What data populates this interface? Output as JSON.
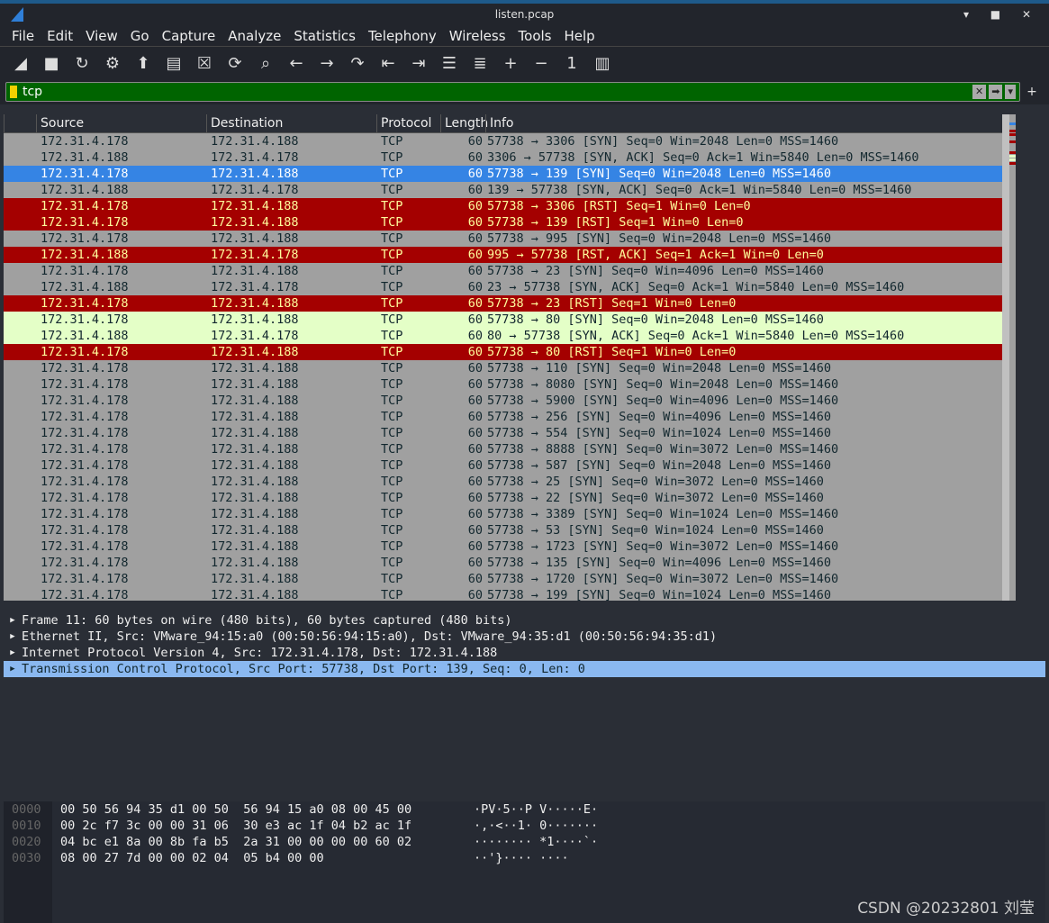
{
  "window": {
    "title": "listen.pcap",
    "controls": "▾ ■ ✕"
  },
  "menu": [
    "File",
    "Edit",
    "View",
    "Go",
    "Capture",
    "Analyze",
    "Statistics",
    "Telephony",
    "Wireless",
    "Tools",
    "Help"
  ],
  "toolbar": [
    {
      "icon": "shark-start-icon",
      "g": "◢"
    },
    {
      "icon": "stop-icon",
      "g": "■"
    },
    {
      "icon": "restart-icon",
      "g": "↻"
    },
    {
      "icon": "options-gear-icon",
      "g": "⚙"
    },
    {
      "icon": "open-icon",
      "g": "⬆"
    },
    {
      "icon": "file-icon",
      "g": "▤"
    },
    {
      "icon": "close-file-icon",
      "g": "☒"
    },
    {
      "icon": "reload-icon",
      "g": "⟳"
    },
    {
      "icon": "search-icon",
      "g": "⌕"
    },
    {
      "icon": "back-icon",
      "g": "←"
    },
    {
      "icon": "forward-icon",
      "g": "→"
    },
    {
      "icon": "goto-icon",
      "g": "↷"
    },
    {
      "icon": "first-packet-icon",
      "g": "⇤"
    },
    {
      "icon": "last-packet-icon",
      "g": "⇥"
    },
    {
      "icon": "autoscroll-icon",
      "g": "☰"
    },
    {
      "icon": "colorize-icon",
      "g": "≣"
    },
    {
      "icon": "zoom-in-icon",
      "g": "+"
    },
    {
      "icon": "zoom-out-icon",
      "g": "−"
    },
    {
      "icon": "normal-size-icon",
      "g": "1"
    },
    {
      "icon": "resize-columns-icon",
      "g": "▥"
    }
  ],
  "filter": {
    "value": "tcp",
    "add": "+"
  },
  "columns": [
    "",
    "Source",
    "Destination",
    "Protocol",
    "Length",
    "Info"
  ],
  "colors": {
    "gray": "#a0a0a0",
    "red": "#a40000",
    "green": "#e4ffc7",
    "selected": "#3584e4"
  },
  "packets": [
    [
      "172.31.4.178",
      "172.31.4.188",
      "TCP",
      "60",
      "57738 → 3306 [SYN] Seq=0 Win=2048 Len=0 MSS=1460",
      "gray"
    ],
    [
      "172.31.4.188",
      "172.31.4.178",
      "TCP",
      "60",
      "3306 → 57738 [SYN, ACK] Seq=0 Ack=1 Win=5840 Len=0 MSS=1460",
      "gray"
    ],
    [
      "172.31.4.178",
      "172.31.4.188",
      "TCP",
      "60",
      "57738 → 139 [SYN] Seq=0 Win=2048 Len=0 MSS=1460",
      "sel"
    ],
    [
      "172.31.4.188",
      "172.31.4.178",
      "TCP",
      "60",
      "139 → 57738 [SYN, ACK] Seq=0 Ack=1 Win=5840 Len=0 MSS=1460",
      "gray"
    ],
    [
      "172.31.4.178",
      "172.31.4.188",
      "TCP",
      "60",
      "57738 → 3306 [RST] Seq=1 Win=0 Len=0",
      "red"
    ],
    [
      "172.31.4.178",
      "172.31.4.188",
      "TCP",
      "60",
      "57738 → 139 [RST] Seq=1 Win=0 Len=0",
      "red"
    ],
    [
      "172.31.4.178",
      "172.31.4.188",
      "TCP",
      "60",
      "57738 → 995 [SYN] Seq=0 Win=2048 Len=0 MSS=1460",
      "gray"
    ],
    [
      "172.31.4.188",
      "172.31.4.178",
      "TCP",
      "60",
      "995 → 57738 [RST, ACK] Seq=1 Ack=1 Win=0 Len=0",
      "red"
    ],
    [
      "172.31.4.178",
      "172.31.4.188",
      "TCP",
      "60",
      "57738 → 23 [SYN] Seq=0 Win=4096 Len=0 MSS=1460",
      "gray"
    ],
    [
      "172.31.4.188",
      "172.31.4.178",
      "TCP",
      "60",
      "23 → 57738 [SYN, ACK] Seq=0 Ack=1 Win=5840 Len=0 MSS=1460",
      "gray"
    ],
    [
      "172.31.4.178",
      "172.31.4.188",
      "TCP",
      "60",
      "57738 → 23 [RST] Seq=1 Win=0 Len=0",
      "red"
    ],
    [
      "172.31.4.178",
      "172.31.4.188",
      "TCP",
      "60",
      "57738 → 80 [SYN] Seq=0 Win=2048 Len=0 MSS=1460",
      "green"
    ],
    [
      "172.31.4.188",
      "172.31.4.178",
      "TCP",
      "60",
      "80 → 57738 [SYN, ACK] Seq=0 Ack=1 Win=5840 Len=0 MSS=1460",
      "green"
    ],
    [
      "172.31.4.178",
      "172.31.4.188",
      "TCP",
      "60",
      "57738 → 80 [RST] Seq=1 Win=0 Len=0",
      "red"
    ],
    [
      "172.31.4.178",
      "172.31.4.188",
      "TCP",
      "60",
      "57738 → 110 [SYN] Seq=0 Win=2048 Len=0 MSS=1460",
      "gray"
    ],
    [
      "172.31.4.178",
      "172.31.4.188",
      "TCP",
      "60",
      "57738 → 8080 [SYN] Seq=0 Win=2048 Len=0 MSS=1460",
      "gray"
    ],
    [
      "172.31.4.178",
      "172.31.4.188",
      "TCP",
      "60",
      "57738 → 5900 [SYN] Seq=0 Win=4096 Len=0 MSS=1460",
      "gray"
    ],
    [
      "172.31.4.178",
      "172.31.4.188",
      "TCP",
      "60",
      "57738 → 256 [SYN] Seq=0 Win=4096 Len=0 MSS=1460",
      "gray"
    ],
    [
      "172.31.4.178",
      "172.31.4.188",
      "TCP",
      "60",
      "57738 → 554 [SYN] Seq=0 Win=1024 Len=0 MSS=1460",
      "gray"
    ],
    [
      "172.31.4.178",
      "172.31.4.188",
      "TCP",
      "60",
      "57738 → 8888 [SYN] Seq=0 Win=3072 Len=0 MSS=1460",
      "gray"
    ],
    [
      "172.31.4.178",
      "172.31.4.188",
      "TCP",
      "60",
      "57738 → 587 [SYN] Seq=0 Win=2048 Len=0 MSS=1460",
      "gray"
    ],
    [
      "172.31.4.178",
      "172.31.4.188",
      "TCP",
      "60",
      "57738 → 25 [SYN] Seq=0 Win=3072 Len=0 MSS=1460",
      "gray"
    ],
    [
      "172.31.4.178",
      "172.31.4.188",
      "TCP",
      "60",
      "57738 → 22 [SYN] Seq=0 Win=3072 Len=0 MSS=1460",
      "gray"
    ],
    [
      "172.31.4.178",
      "172.31.4.188",
      "TCP",
      "60",
      "57738 → 3389 [SYN] Seq=0 Win=1024 Len=0 MSS=1460",
      "gray"
    ],
    [
      "172.31.4.178",
      "172.31.4.188",
      "TCP",
      "60",
      "57738 → 53 [SYN] Seq=0 Win=1024 Len=0 MSS=1460",
      "gray"
    ],
    [
      "172.31.4.178",
      "172.31.4.188",
      "TCP",
      "60",
      "57738 → 1723 [SYN] Seq=0 Win=3072 Len=0 MSS=1460",
      "gray"
    ],
    [
      "172.31.4.178",
      "172.31.4.188",
      "TCP",
      "60",
      "57738 → 135 [SYN] Seq=0 Win=4096 Len=0 MSS=1460",
      "gray"
    ],
    [
      "172.31.4.178",
      "172.31.4.188",
      "TCP",
      "60",
      "57738 → 1720 [SYN] Seq=0 Win=3072 Len=0 MSS=1460",
      "gray"
    ],
    [
      "172.31.4.178",
      "172.31.4.188",
      "TCP",
      "60",
      "57738 → 199 [SYN] Seq=0 Win=1024 Len=0 MSS=1460",
      "gray"
    ]
  ],
  "details": [
    {
      "text": "Frame 11: 60 bytes on wire (480 bits), 60 bytes captured (480 bits)",
      "selected": false
    },
    {
      "text": "Ethernet II, Src: VMware_94:15:a0 (00:50:56:94:15:a0), Dst: VMware_94:35:d1 (00:50:56:94:35:d1)",
      "selected": false
    },
    {
      "text": "Internet Protocol Version 4, Src: 172.31.4.178, Dst: 172.31.4.188",
      "selected": false
    },
    {
      "text": "Transmission Control Protocol, Src Port: 57738, Dst Port: 139, Seq: 0, Len: 0",
      "selected": true
    }
  ],
  "hex": [
    {
      "offset": "0000",
      "bytes": "00 50 56 94 35 d1 00 50  56 94 15 a0 08 00 45 00",
      "ascii": "·PV·5··P V·····E·"
    },
    {
      "offset": "0010",
      "bytes": "00 2c f7 3c 00 00 31 06  30 e3 ac 1f 04 b2 ac 1f",
      "ascii": "·,·<··1· 0·······"
    },
    {
      "offset": "0020",
      "bytes": "04 bc e1 8a 00 8b fa b5  2a 31 00 00 00 00 60 02",
      "ascii": "········ *1····`·"
    },
    {
      "offset": "0030",
      "bytes": "08 00 27 7d 00 00 02 04  05 b4 00 00",
      "ascii": "··'}···· ····"
    }
  ],
  "watermark": "CSDN @20232801 刘莹"
}
